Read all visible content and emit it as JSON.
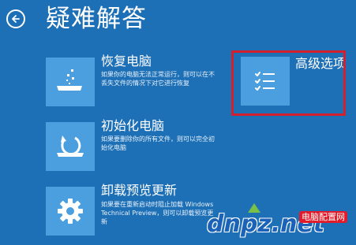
{
  "header": {
    "title": "疑难解答"
  },
  "options": {
    "recover": {
      "title": "恢复电脑",
      "desc": "如果你的电脑无法正常运行，则可以在不丢失文件的情况下对它进行恢复"
    },
    "reset": {
      "title": "初始化电脑",
      "desc": "如果要删除你的所有文件，则可以完全初始化电脑"
    },
    "uninstall": {
      "title": "卸载预览更新",
      "desc": "如果要在重新启动时阻止加载 Windows Technical Preview，则可以卸载预览更新"
    },
    "advanced": {
      "title": "高级选项"
    }
  },
  "watermark": {
    "domain": "dnpz.net",
    "badge": "电脑配置网"
  },
  "colors": {
    "background": "#1d6fb6",
    "tile": "#4b9fdf",
    "highlight": "#d4202e"
  }
}
